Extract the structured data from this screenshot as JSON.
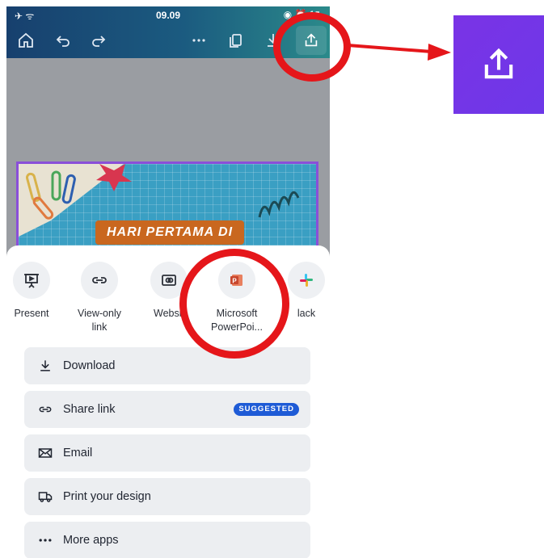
{
  "status_bar": {
    "left": "✈ ᯤ",
    "time": "09.09",
    "right": "◉ ⏰ 1▮"
  },
  "toolbar": {
    "icons": [
      "home-icon",
      "undo-icon",
      "redo-icon",
      "more-icon",
      "copy-icon",
      "download-icon",
      "share-icon"
    ]
  },
  "slide": {
    "title": "HARI PERTAMA DI"
  },
  "share_sheet": {
    "apps": [
      {
        "label": "Present",
        "icon": "present-icon"
      },
      {
        "label": "View-only link",
        "icon": "link-icon"
      },
      {
        "label": "Websit",
        "icon": "website-icon"
      },
      {
        "label": "Microsoft PowerPoi...",
        "icon": "powerpoint-icon"
      },
      {
        "label": "lack",
        "icon": "slack-icon"
      }
    ],
    "actions": [
      {
        "label": "Download",
        "icon": "download-icon"
      },
      {
        "label": "Share link",
        "icon": "share-link-icon",
        "badge": "SUGGESTED"
      },
      {
        "label": "Email",
        "icon": "email-icon"
      },
      {
        "label": "Print your design",
        "icon": "print-truck-icon"
      },
      {
        "label": "More apps",
        "icon": "more-dots-icon"
      }
    ]
  },
  "colors": {
    "annotation_red": "#e5161a",
    "share_button_purple": "#7a33e6",
    "badge_blue": "#1e5bd6",
    "powerpoint_orange": "#c8472d"
  }
}
